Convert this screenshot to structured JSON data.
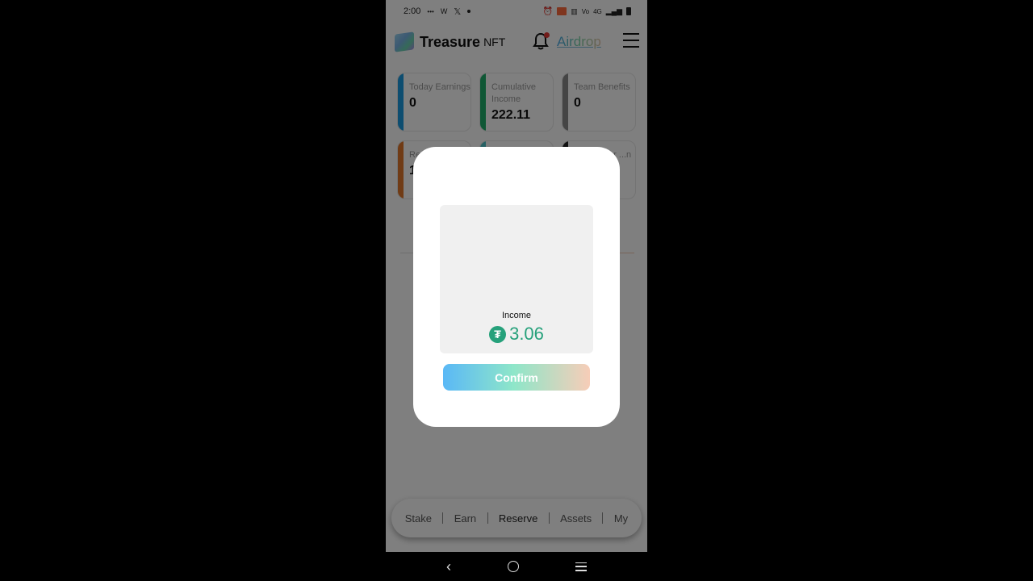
{
  "status_bar": {
    "time": "2:00",
    "left_icons": [
      "dots-icon",
      "wifi-calling-icon",
      "x-app-icon",
      "dot-icon"
    ],
    "right_icons": [
      "alarm-icon",
      "cast-icon",
      "vibrate-icon",
      "volte-icon",
      "4g-icon",
      "signal-icon",
      "battery-icon"
    ],
    "network": "4G"
  },
  "header": {
    "brand": "Treasure",
    "brand_suffix": "NFT",
    "airdrop_label": "Airdrop",
    "notification_badge": true
  },
  "cards": [
    {
      "label": "Today Earnings",
      "value": "0",
      "color": "#1a9be0"
    },
    {
      "label": "Cumulative Income",
      "value": "222.11",
      "color": "#1fae6a"
    },
    {
      "label": "Team Benefits",
      "value": "0",
      "color": "#8a8a8a"
    },
    {
      "label": "Re...",
      "value": "1",
      "color": "#e0772a"
    },
    {
      "label": "",
      "value": "",
      "color": "#4ec3c8"
    },
    {
      "label": "...r ...n",
      "value": "",
      "color": "#222222"
    }
  ],
  "modal": {
    "income_label": "Income",
    "currency_icon": "tether-icon",
    "currency_symbol": "₮",
    "amount": "3.06",
    "confirm_label": "Confirm"
  },
  "tabbar": {
    "items": [
      "Stake",
      "Earn",
      "Reserve",
      "Assets",
      "My"
    ],
    "active": "Reserve"
  },
  "navbar": {
    "back": "‹"
  }
}
